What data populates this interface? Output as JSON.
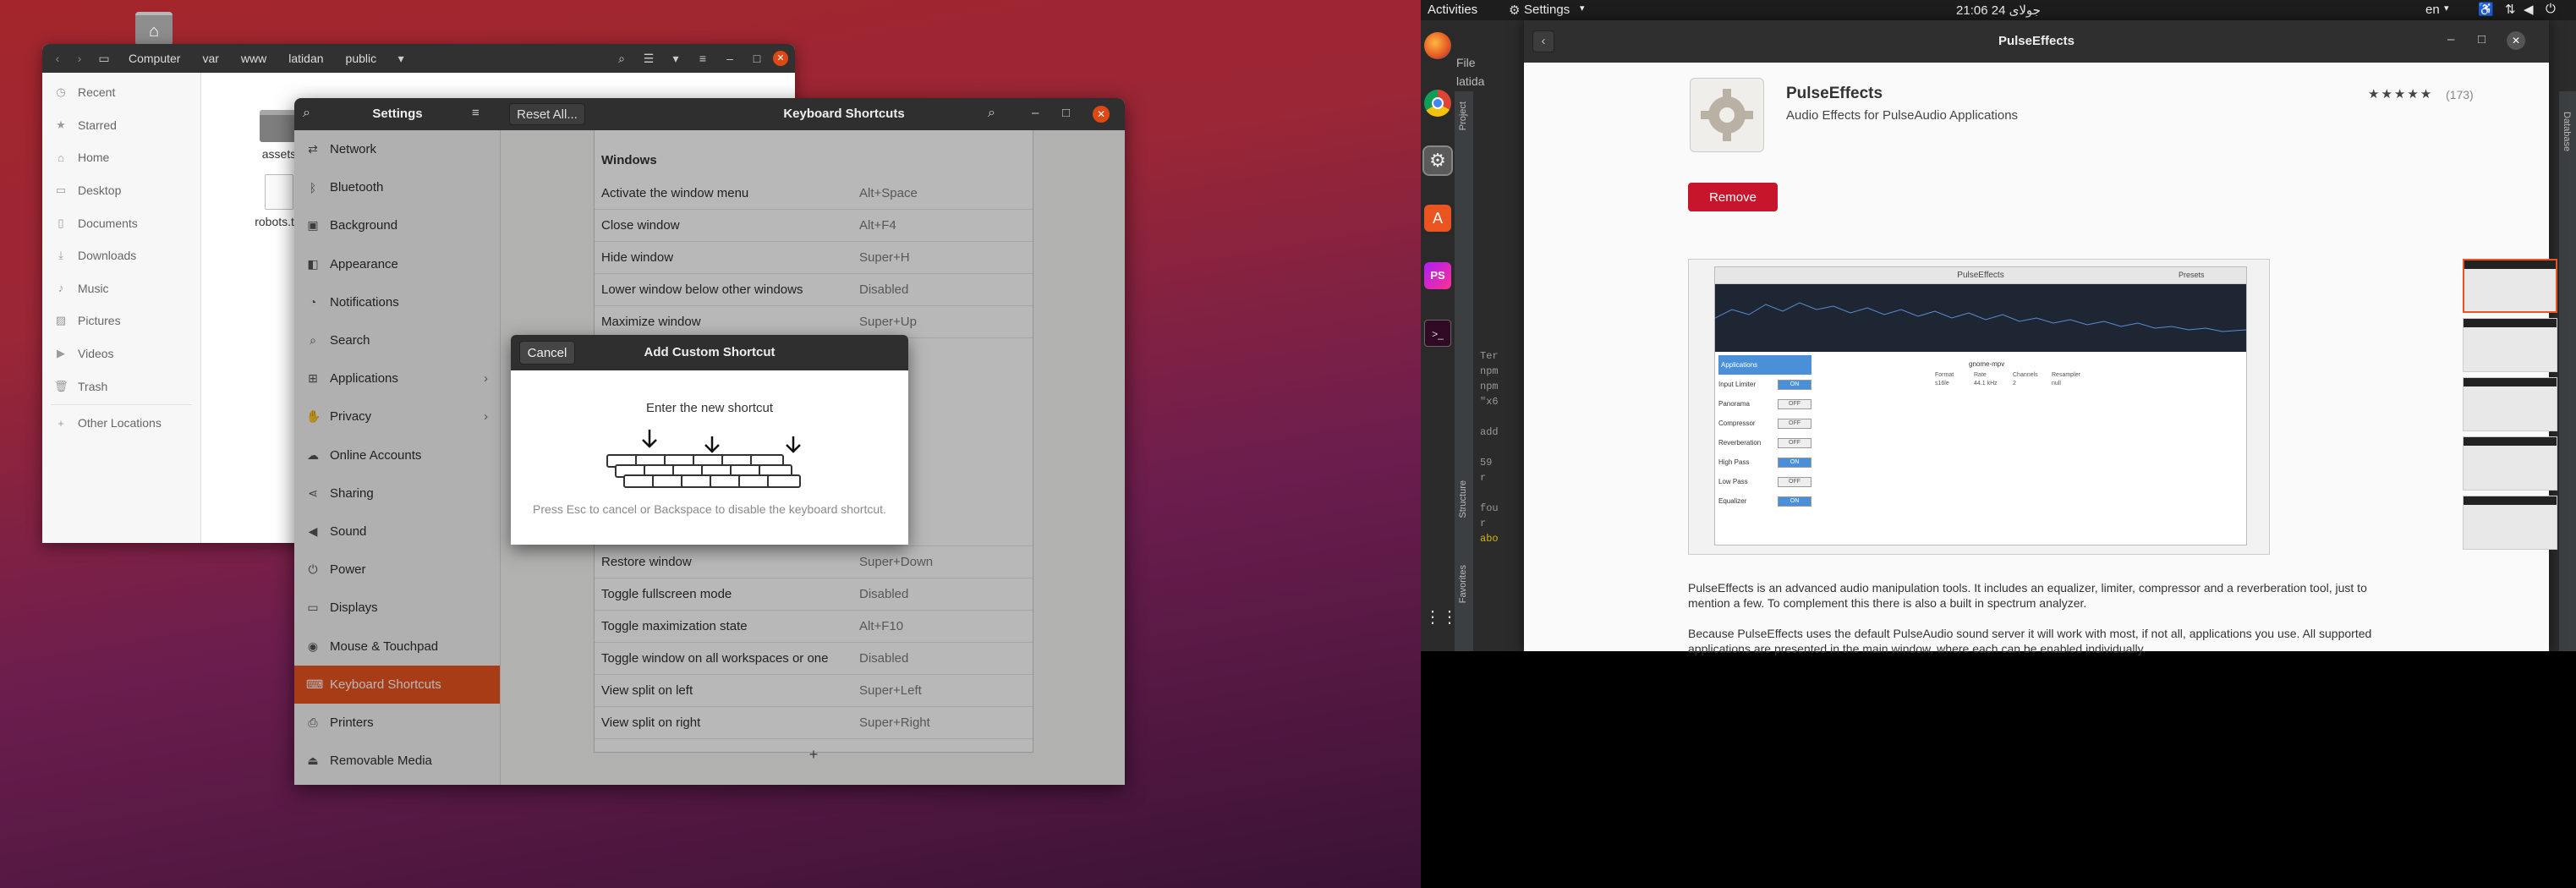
{
  "nautilus": {
    "path": [
      "Computer",
      "var",
      "www",
      "latidan",
      "public"
    ],
    "sidebar": [
      {
        "label": "Recent",
        "icon": "clock-icon"
      },
      {
        "label": "Starred",
        "icon": "star-icon"
      },
      {
        "label": "Home",
        "icon": "home-icon"
      },
      {
        "label": "Desktop",
        "icon": "desktop-icon"
      },
      {
        "label": "Documents",
        "icon": "documents-icon"
      },
      {
        "label": "Downloads",
        "icon": "downloads-icon"
      },
      {
        "label": "Music",
        "icon": "music-icon"
      },
      {
        "label": "Pictures",
        "icon": "pictures-icon"
      },
      {
        "label": "Videos",
        "icon": "videos-icon"
      },
      {
        "label": "Trash",
        "icon": "trash-icon"
      },
      {
        "label": "Other Locations",
        "icon": "plus-icon"
      }
    ],
    "files": [
      "assets",
      "robots.txt"
    ]
  },
  "settings": {
    "title": "Settings",
    "reset_label": "Reset All...",
    "panel_title": "Keyboard Shortcuts",
    "sidebar": [
      {
        "label": "Network",
        "icon": "network-icon"
      },
      {
        "label": "Bluetooth",
        "icon": "bluetooth-icon"
      },
      {
        "label": "Background",
        "icon": "background-icon"
      },
      {
        "label": "Appearance",
        "icon": "appearance-icon"
      },
      {
        "label": "Notifications",
        "icon": "bell-icon"
      },
      {
        "label": "Search",
        "icon": "search-icon"
      },
      {
        "label": "Applications",
        "icon": "applications-icon",
        "chevron": "›"
      },
      {
        "label": "Privacy",
        "icon": "privacy-icon",
        "chevron": "›"
      },
      {
        "label": "Online Accounts",
        "icon": "cloud-icon"
      },
      {
        "label": "Sharing",
        "icon": "sharing-icon"
      },
      {
        "label": "Sound",
        "icon": "speaker-icon"
      },
      {
        "label": "Power",
        "icon": "power-icon"
      },
      {
        "label": "Displays",
        "icon": "display-icon"
      },
      {
        "label": "Mouse & Touchpad",
        "icon": "mouse-icon"
      },
      {
        "label": "Keyboard Shortcuts",
        "icon": "keyboard-icon",
        "active": true
      },
      {
        "label": "Printers",
        "icon": "printer-icon"
      },
      {
        "label": "Removable Media",
        "icon": "media-icon"
      }
    ],
    "section": "Windows",
    "shortcuts_top": [
      {
        "name": "Activate the window menu",
        "accel": "Alt+Space"
      },
      {
        "name": "Close window",
        "accel": "Alt+F4"
      },
      {
        "name": "Hide window",
        "accel": "Super+H"
      },
      {
        "name": "Lower window below other windows",
        "accel": "Disabled"
      },
      {
        "name": "Maximize window",
        "accel": "Super+Up"
      }
    ],
    "shortcuts_bottom": [
      {
        "name": "Restore window",
        "accel": "Super+Down"
      },
      {
        "name": "Toggle fullscreen mode",
        "accel": "Disabled"
      },
      {
        "name": "Toggle maximization state",
        "accel": "Alt+F10"
      },
      {
        "name": "Toggle window on all workspaces or one",
        "accel": "Disabled"
      },
      {
        "name": "View split on left",
        "accel": "Super+Left"
      },
      {
        "name": "View split on right",
        "accel": "Super+Right"
      }
    ],
    "add_label": "+"
  },
  "dialog": {
    "title": "Add Custom Shortcut",
    "cancel_label": "Cancel",
    "prompt": "Enter the new shortcut",
    "hint": "Press Esc to cancel or Backspace to disable the keyboard shortcut."
  },
  "topbar": {
    "activities": "Activities",
    "app_menu": "Settings",
    "clock": "21:06 24 جولای",
    "lang": "en"
  },
  "software": {
    "title": "PulseEffects",
    "app_name": "PulseEffects",
    "summary": "Audio Effects for PulseAudio Applications",
    "stars": "★★★★★",
    "rating_count": "(173)",
    "remove_label": "Remove",
    "description": [
      "PulseEffects is an advanced audio manipulation tools. It includes an equalizer, limiter, compressor and a reverberation tool, just to mention a few. To complement this there is also a built in spectrum analyzer.",
      "Because PulseEffects uses the default PulseAudio sound server it will work with most, if not all, applications you use. All supported applications are presented in the main window, where each can be enabled individually."
    ],
    "screenshot": {
      "title": "PulseEffects",
      "presets": "Presets",
      "user_label": "gnome-mpv",
      "meta": {
        "headers": [
          "Format",
          "Rate",
          "Channels",
          "Resampler"
        ],
        "values": [
          "s16le",
          "44.1 kHz",
          "2",
          "null"
        ]
      },
      "effects": [
        {
          "name": "Applications",
          "state": ""
        },
        {
          "name": "Input Limiter",
          "state": "ON"
        },
        {
          "name": "Panorama",
          "state": "OFF"
        },
        {
          "name": "Compressor",
          "state": "OFF"
        },
        {
          "name": "Reverberation",
          "state": "OFF"
        },
        {
          "name": "High Pass",
          "state": "ON"
        },
        {
          "name": "Low Pass",
          "state": "OFF"
        },
        {
          "name": "Equalizer",
          "state": "ON"
        }
      ]
    }
  },
  "ide": {
    "menu_file": "File",
    "project_name": "latida",
    "side_labels": [
      "Project",
      "Structure",
      "Favorites"
    ],
    "right_labels": [
      "Database"
    ],
    "code_lines": [
      "Ter",
      "npm",
      "npm",
      "\"x6",
      "add",
      "59",
      "r",
      "fou",
      "r",
      "abo"
    ]
  }
}
